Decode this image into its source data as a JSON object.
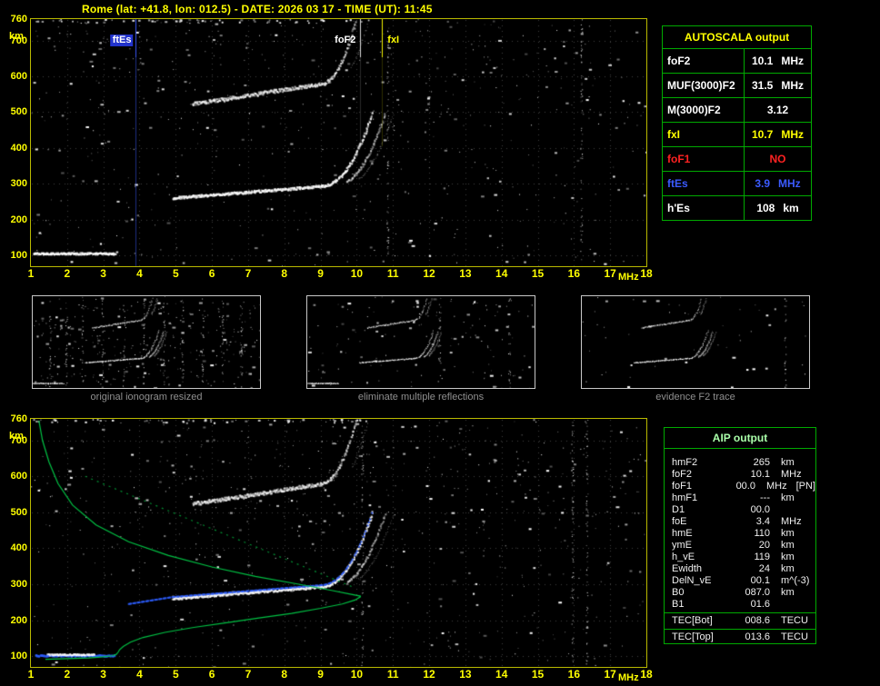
{
  "header": {
    "title": "Rome (lat: +41.8, lon: 012.5) - DATE: 2026 03 17 - TIME (UT): 11:45"
  },
  "axes": {
    "x_unit": "MHz",
    "y_unit": "km",
    "x_ticks": [
      1,
      2,
      3,
      4,
      5,
      6,
      7,
      8,
      9,
      10,
      11,
      12,
      13,
      14,
      15,
      16,
      17,
      18
    ],
    "y_ticks": [
      760,
      700,
      600,
      500,
      400,
      300,
      200,
      100
    ],
    "x_range": [
      1,
      18
    ],
    "y_range": [
      100,
      760
    ]
  },
  "iono": {
    "fof2": 10.1,
    "fxi": 10.7,
    "ftes": 3.9,
    "h_es": 108,
    "hmf2": 265,
    "foe": 3.4,
    "hme": 110
  },
  "markers": [
    {
      "id": "ftEs",
      "label": "ftEs",
      "freq": 3.9,
      "color": "#3b5bff",
      "text_color": "#ffffff",
      "bg": "#2233cc",
      "align": "left"
    },
    {
      "id": "foF2",
      "label": "foF2",
      "freq": 10.1,
      "color": "#e8e8e8",
      "text_color": "#ffffff",
      "align": "left"
    },
    {
      "id": "fxI",
      "label": "fxI",
      "freq": 10.7,
      "color": "#ffff00",
      "text_color": "#ffff00",
      "align": "right"
    }
  ],
  "autoscala_table": {
    "title": "AUTOSCALA output",
    "rows": [
      {
        "param": "foF2",
        "value": "10.1",
        "unit": "MHz",
        "color": "#ffffff"
      },
      {
        "param": "MUF(3000)F2",
        "value": "31.5",
        "unit": "MHz",
        "color": "#ffffff"
      },
      {
        "param": "M(3000)F2",
        "value": "3.12",
        "unit": "",
        "color": "#ffffff"
      },
      {
        "param": "fxI",
        "value": "10.7",
        "unit": "MHz",
        "color": "#ffff00"
      },
      {
        "param": "foF1",
        "value": "NO",
        "unit": "",
        "color": "#ff2222"
      },
      {
        "param": "ftEs",
        "value": "3.9",
        "unit": "MHz",
        "color": "#3b5bff"
      },
      {
        "param": "h'Es",
        "value": "108",
        "unit": "km",
        "color": "#ffffff"
      }
    ]
  },
  "thumbnails": [
    {
      "caption": "original ionogram resized"
    },
    {
      "caption": "eliminate multiple reflections"
    },
    {
      "caption": "evidence F2 trace"
    }
  ],
  "aip_table": {
    "title": "AIP output",
    "rows": [
      {
        "param": "hmF2",
        "value": "265",
        "unit": "km"
      },
      {
        "param": "foF2",
        "value": "10.1",
        "unit": "MHz"
      },
      {
        "param": "foF1",
        "value": "00.0",
        "unit": "MHz",
        "note": "[PN]"
      },
      {
        "param": "hmF1",
        "value": "---",
        "unit": "km"
      },
      {
        "param": "D1",
        "value": "00.0",
        "unit": ""
      },
      {
        "param": "foE",
        "value": "3.4",
        "unit": "MHz"
      },
      {
        "param": "hmE",
        "value": "110",
        "unit": "km"
      },
      {
        "param": "ymE",
        "value": "20",
        "unit": "km"
      },
      {
        "param": "h_vE",
        "value": "119",
        "unit": "km"
      },
      {
        "param": "Ewidth",
        "value": "24",
        "unit": "km"
      },
      {
        "param": "DelN_vE",
        "value": "00.1",
        "unit": "m^(-3)"
      },
      {
        "param": "B0",
        "value": "087.0",
        "unit": "km"
      },
      {
        "param": "B1",
        "value": "01.6",
        "unit": ""
      }
    ],
    "tec_rows": [
      {
        "param": "TEC[Bot]",
        "value": "008.6",
        "unit": "TECU"
      },
      {
        "param": "TEC[Top]",
        "value": "013.6",
        "unit": "TECU"
      }
    ]
  }
}
